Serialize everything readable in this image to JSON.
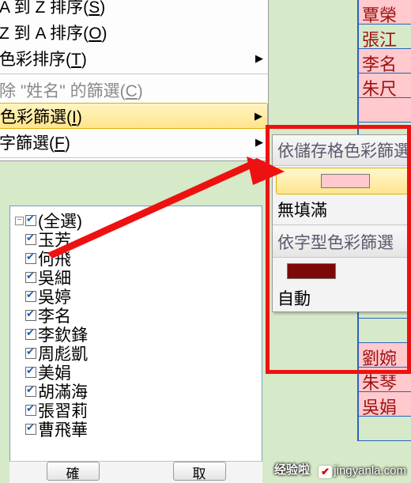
{
  "menu": {
    "sortAZ": "A 到 Z 排序(<u class='acc'>S</u>)",
    "sortZA": "Z 到 A 排序(<u class='acc'>O</u>)",
    "sortColor": "色彩排序(<u class='acc'>T</u>)",
    "clearFilter": "除 \"姓名\" 的篩選(<u class='acc'>C</u>)",
    "colorFilter": "色彩篩選(<u class='acc'>I</u>)",
    "textFilter": "字篩選(<u class='acc'>F</u>)"
  },
  "filter": {
    "items": [
      "(全選)",
      "玉芳",
      "何飛",
      "吳細",
      "吳婷",
      "李名",
      "李欽鋒",
      "周彪凱",
      "美娟",
      "胡滿海",
      "張習莉",
      "曹飛華"
    ]
  },
  "submenu": {
    "cellColorTitle": "依儲存格色彩篩選",
    "noFill": "無填滿",
    "fontColorTitle": "依字型色彩篩選",
    "auto": "自動"
  },
  "cells": [
    "覃榮",
    "張江",
    "李名",
    "朱尺",
    "",
    "",
    "",
    "",
    "",
    "",
    "",
    "",
    "",
    "",
    "劉婉",
    "朱琴",
    "吳娟",
    ""
  ],
  "cellStyles": [
    "pink",
    "",
    "pink",
    "pink",
    "pink",
    "",
    "",
    "",
    "",
    "",
    "",
    "",
    "",
    "",
    "pink",
    "pink",
    "pink",
    ""
  ],
  "buttons": {
    "ok": "確",
    "cancel": "取"
  },
  "watermark": {
    "brand": "经验啦",
    "check": "✔",
    "url": "jingyanla.com"
  }
}
